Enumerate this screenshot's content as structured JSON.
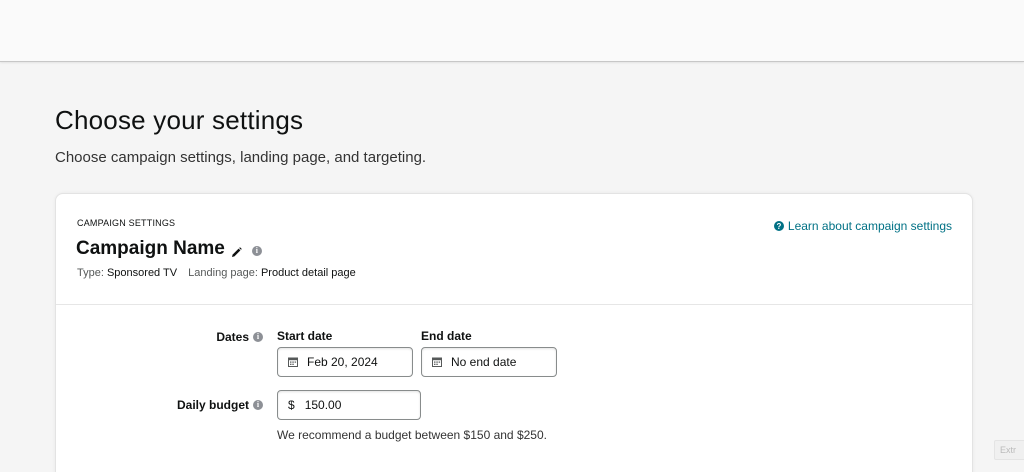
{
  "header": {
    "title": "Choose your settings",
    "subtitle": "Choose campaign settings, landing page, and targeting."
  },
  "campaign_settings": {
    "section_label": "CAMPAIGN SETTINGS",
    "campaign_name": "Campaign Name",
    "learn_link": "Learn about campaign settings",
    "type_label": "Type:",
    "type_value": "Sponsored TV",
    "landing_label": "Landing page:",
    "landing_value": "Product detail page"
  },
  "form": {
    "dates_label": "Dates",
    "start_caption": "Start date",
    "start_value": "Feb 20, 2024",
    "end_caption": "End date",
    "end_value": "No end date",
    "budget_label": "Daily budget",
    "currency": "$",
    "budget_value": "150.00",
    "budget_hint": "We recommend a budget between $150 and $250."
  },
  "corner_badge": "Extr",
  "icons": {
    "edit": "pencil-icon",
    "info": "info-icon",
    "help": "help-icon",
    "calendar": "calendar-icon"
  },
  "colors": {
    "link": "#007185",
    "background": "#f5f5f5",
    "card": "#ffffff"
  }
}
